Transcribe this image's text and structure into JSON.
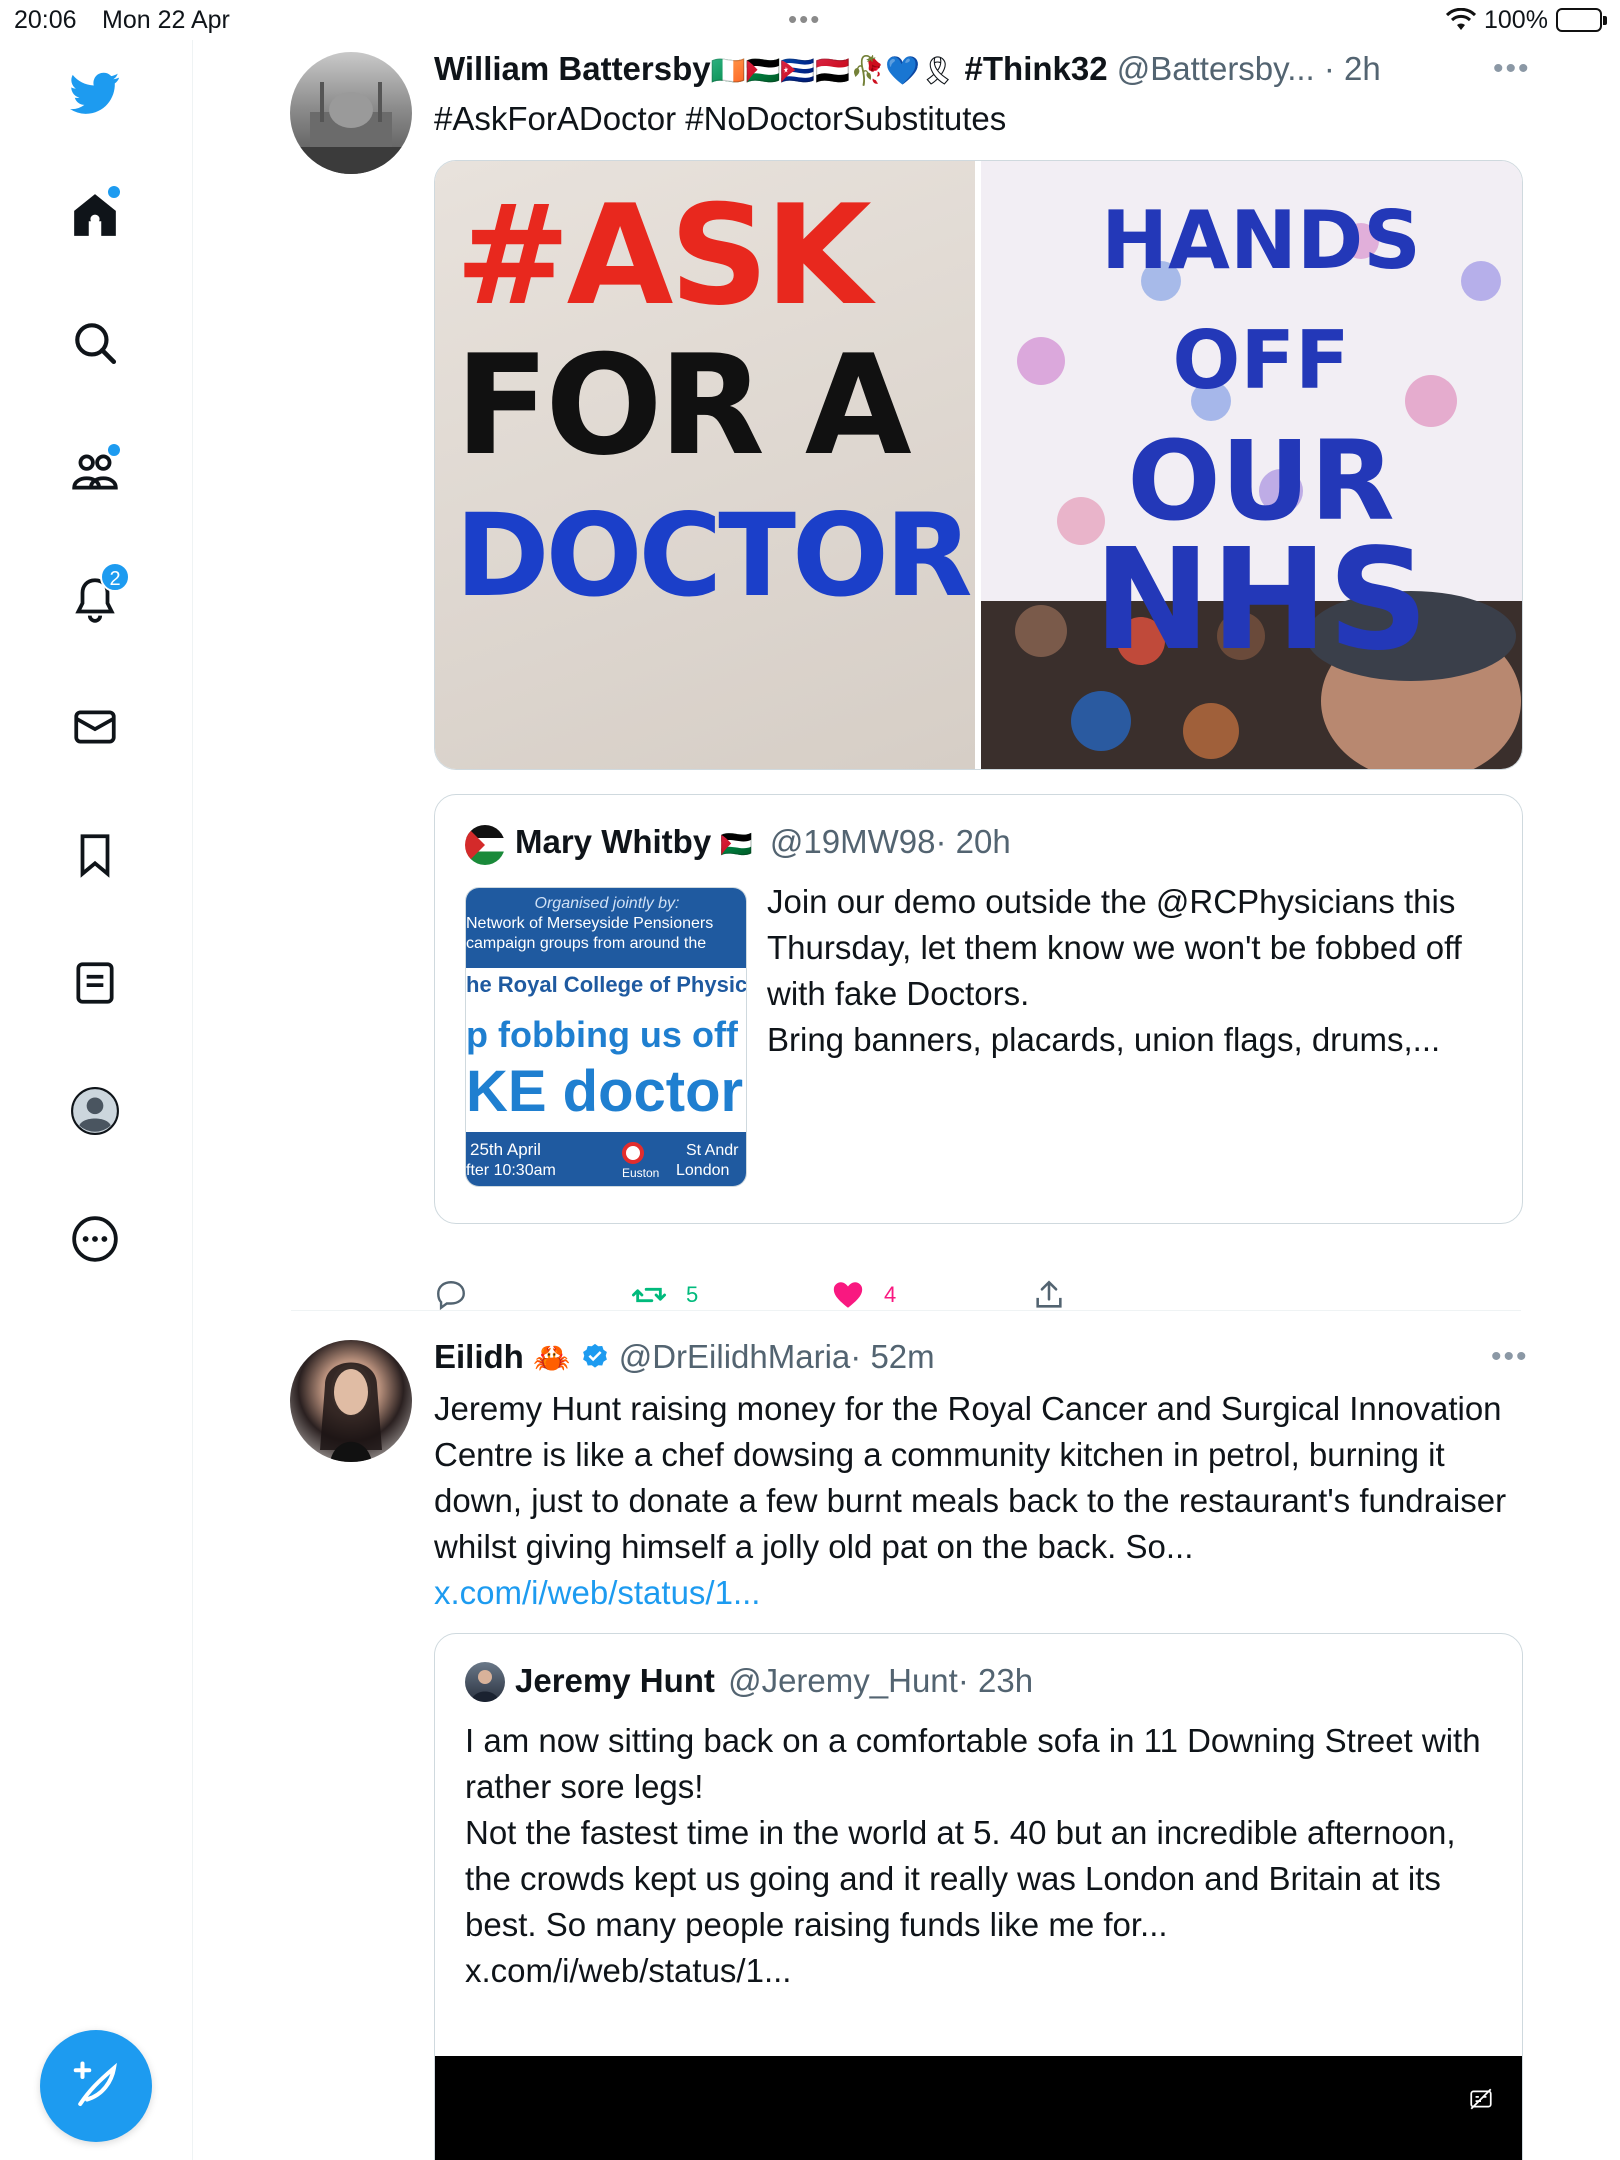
{
  "status": {
    "time": "20:06",
    "date": "Mon 22 Apr",
    "battery": "100%"
  },
  "sidebar": {
    "items": [
      "twitter-logo",
      "home",
      "search",
      "communities",
      "notifications",
      "messages",
      "bookmarks",
      "lists",
      "profile",
      "more"
    ],
    "notifications_badge": "2"
  },
  "tweets": [
    {
      "name": "William Battersby",
      "flags": "🇮🇪🇵🇸🇨🇺🇾🇪🥀💙🎗",
      "name_suffix": "#Think32",
      "handle": "@Battersby...",
      "time": "· 2h",
      "hashtags": "#AskForADoctor #NoDoctorSubstitutes",
      "media": {
        "left_line1": "#ASK",
        "left_line2": "FOR A",
        "left_line3": "DOCTOR",
        "right_line1": "HANDS OFF",
        "right_line2": "OUR",
        "right_line3": "NHS"
      },
      "quote": {
        "name": "Mary Whitby",
        "flag": "🇵🇸",
        "handle": "@19MW98",
        "time": "· 20h",
        "text": "Join our demo outside the @RCPhysicians this Thursday, let them know we won't be fobbed off with fake Doctors.\nBring banners, placards, union flags, drums,...",
        "thumb": {
          "line1": "Organised jointly by:",
          "line2": "Network of Merseyside Pensioners",
          "line3": "campaign groups from around the",
          "line4": "he Royal College of Physici",
          "line5": "p fobbing us off w",
          "line6": "KE doctor",
          "line7": "25th April",
          "line8": "fter 10:30am",
          "line9": "St Andr",
          "line10": "London",
          "line11": "Euston"
        }
      },
      "stats": {
        "retweets": "5",
        "likes": "4"
      }
    },
    {
      "name": "Eilidh",
      "emoji": "🦀",
      "handle": "@DrEilidhMaria",
      "time": "· 52m",
      "text": "Jeremy Hunt raising money for the Royal Cancer and Surgical Innovation Centre is like a chef dowsing a community kitchen in petrol, burning it down, just to donate a few burnt meals back to the restaurant's fundraiser whilst giving himself a jolly old pat on the back. So...",
      "text_link": "x.com/i/web/status/1...",
      "quote": {
        "name": "Jeremy Hunt",
        "handle": "@Jeremy_Hunt",
        "time": "· 23h",
        "text": "I am now sitting back on a comfortable sofa in 11 Downing Street with rather sore legs!\nNot the fastest time in the world at 5. 40 but an incredible afternoon, the crowds kept us going and it really was London and Britain at its best. So many people raising funds like me for...\nx.com/i/web/status/1..."
      }
    }
  ],
  "colors": {
    "accent": "#1d9bf0",
    "like": "#f91880",
    "retweet": "#00ba7c",
    "muted": "#536471"
  }
}
